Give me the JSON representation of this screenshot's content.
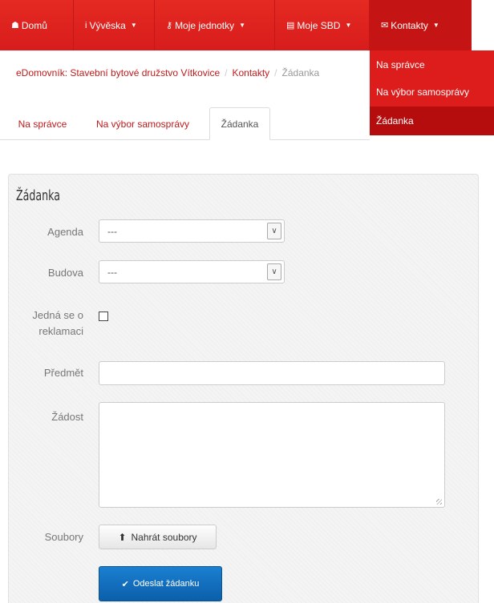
{
  "navbar": {
    "items": [
      {
        "label": "Domů",
        "icon": "home-icon",
        "glyph": "☗"
      },
      {
        "label": "Vývěska",
        "icon": "info-icon",
        "glyph": "i",
        "caret": "▼"
      },
      {
        "label": "Moje jednotky",
        "icon": "key-icon",
        "glyph": "⚷",
        "caret": "▼"
      },
      {
        "label": "Moje SBD",
        "icon": "building-icon",
        "glyph": "▤",
        "caret": "▼"
      },
      {
        "label": "Kontakty",
        "icon": "envelope-icon",
        "glyph": "✉",
        "caret": "▼"
      }
    ],
    "accent": "#e02020"
  },
  "dropdown": {
    "items": [
      {
        "label": "Na správce"
      },
      {
        "label": "Na výbor samosprávy"
      },
      {
        "label": "Žádanka"
      }
    ]
  },
  "breadcrumb": {
    "items": [
      {
        "label": "eDomovník: Stavební bytové družstvo Vítkovice"
      },
      {
        "label": "Kontakty"
      },
      {
        "label": "Žádanka"
      }
    ],
    "separator": "/"
  },
  "tabs": [
    {
      "label": "Na správce"
    },
    {
      "label": "Na výbor samosprávy"
    },
    {
      "label": "Žádanka"
    }
  ],
  "form": {
    "title": "Žádanka",
    "agenda": {
      "label": "Agenda",
      "value": "---"
    },
    "budova": {
      "label": "Budova",
      "value": "---"
    },
    "reklamace": {
      "label_line1": "Jedná se o",
      "label_line2": "reklamaci",
      "checked": false
    },
    "predmet": {
      "label": "Předmět",
      "value": ""
    },
    "zadost": {
      "label": "Žádost",
      "value": ""
    },
    "soubory": {
      "label": "Soubory",
      "button": "Nahrát soubory"
    },
    "submit": {
      "label": "Odeslat žádanku"
    }
  },
  "colors": {
    "submit": "#0b6cbf",
    "link": "#c01a1a"
  }
}
